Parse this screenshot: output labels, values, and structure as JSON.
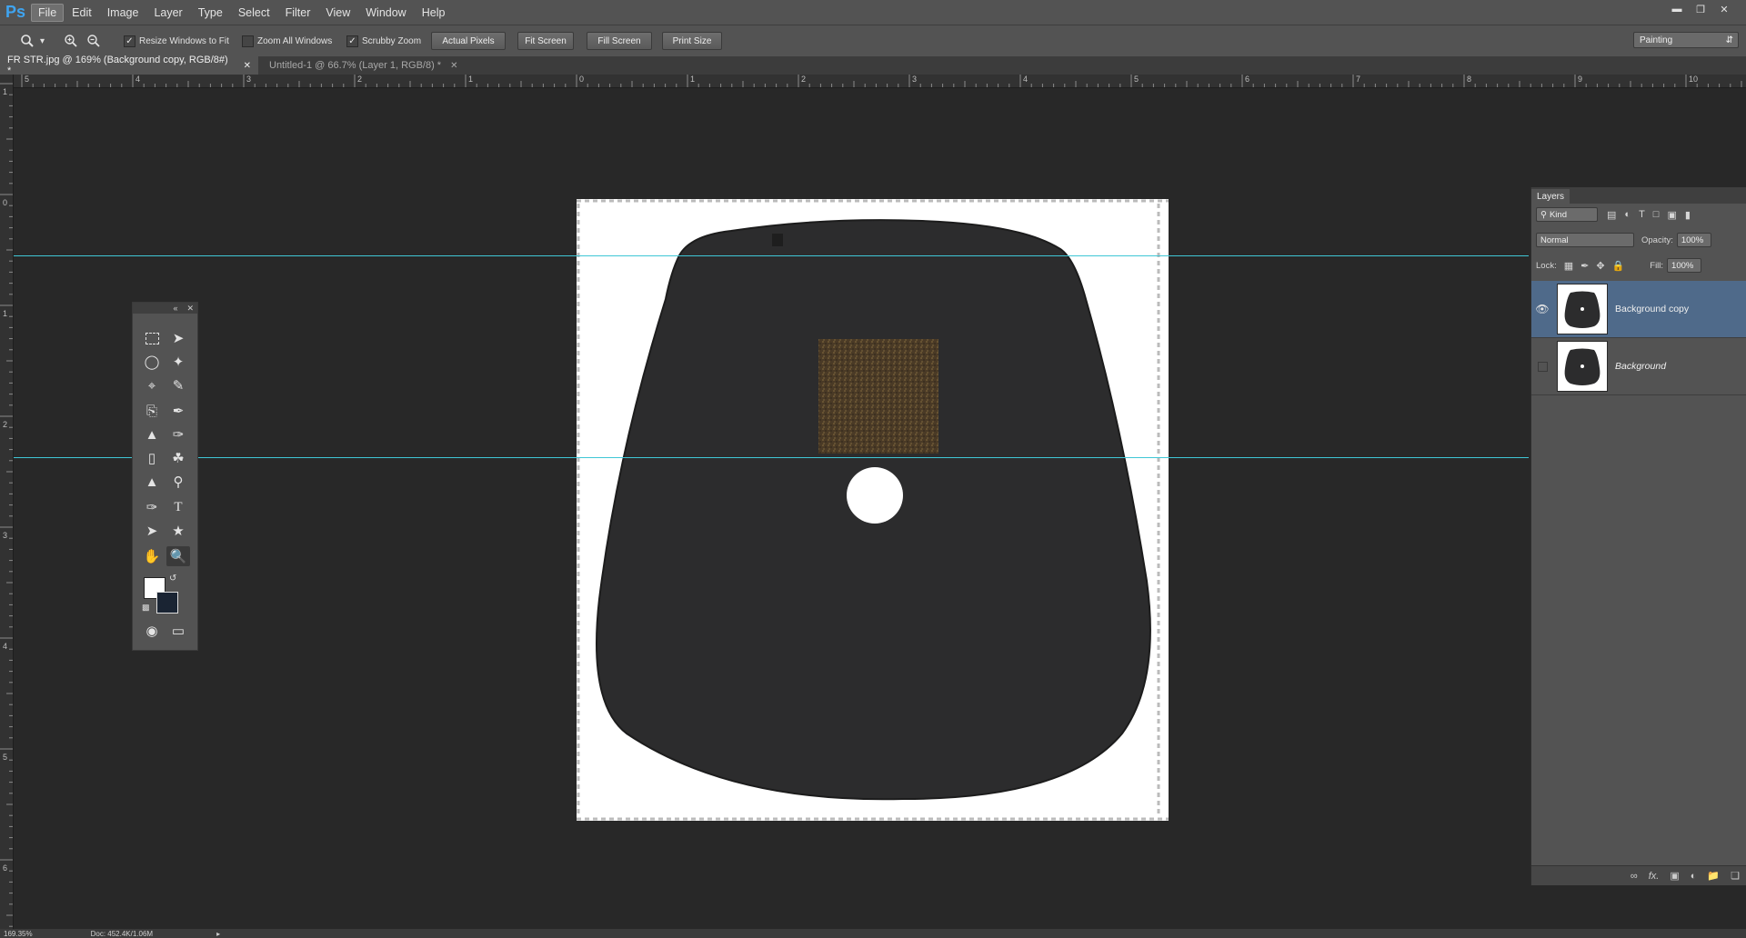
{
  "app": {
    "logo": "Ps"
  },
  "menu": [
    {
      "label": "File",
      "active": true
    },
    {
      "label": "Edit"
    },
    {
      "label": "Image"
    },
    {
      "label": "Layer"
    },
    {
      "label": "Type"
    },
    {
      "label": "Select"
    },
    {
      "label": "Filter"
    },
    {
      "label": "View"
    },
    {
      "label": "Window"
    },
    {
      "label": "Help"
    }
  ],
  "options": {
    "resize_windows": "Resize Windows to Fit",
    "zoom_all_windows": "Zoom All Windows",
    "scrubby_zoom": "Scrubby Zoom",
    "actual_pixels": "Actual Pixels",
    "fit_screen": "Fit Screen",
    "fill_screen": "Fill Screen",
    "print_size": "Print Size",
    "workspace": "Painting"
  },
  "tabs": [
    {
      "label": "FR STR.jpg @ 169% (Background copy, RGB/8#) *",
      "active": true
    },
    {
      "label": "Untitled-1 @ 66.7% (Layer 1, RGB/8) *",
      "active": false
    }
  ],
  "ruler": {
    "h_labels": [
      "5",
      "4",
      "3",
      "2",
      "1",
      "0",
      "1",
      "2",
      "3",
      "4",
      "5",
      "6",
      "7",
      "8",
      "9",
      "10"
    ],
    "v_labels": [
      "1",
      "0",
      "1",
      "2",
      "3",
      "4",
      "5",
      "6"
    ]
  },
  "layers_panel": {
    "tab": "Layers",
    "filter_kind": "Kind",
    "blend_mode": "Normal",
    "opacity_label": "Opacity:",
    "opacity_value": "100%",
    "lock_label": "Lock:",
    "fill_label": "Fill:",
    "fill_value": "100%",
    "layers": [
      {
        "name": "Background copy",
        "visible": true,
        "selected": true
      },
      {
        "name": "Background",
        "visible": false,
        "selected": false
      }
    ]
  },
  "status": {
    "zoom": "169.35%",
    "doc": "Doc: 452.4K/1.06M"
  },
  "colors": {
    "guide": "#3fc7d6",
    "selection": "#4f6a8a",
    "accent": "#3fa4f0"
  }
}
